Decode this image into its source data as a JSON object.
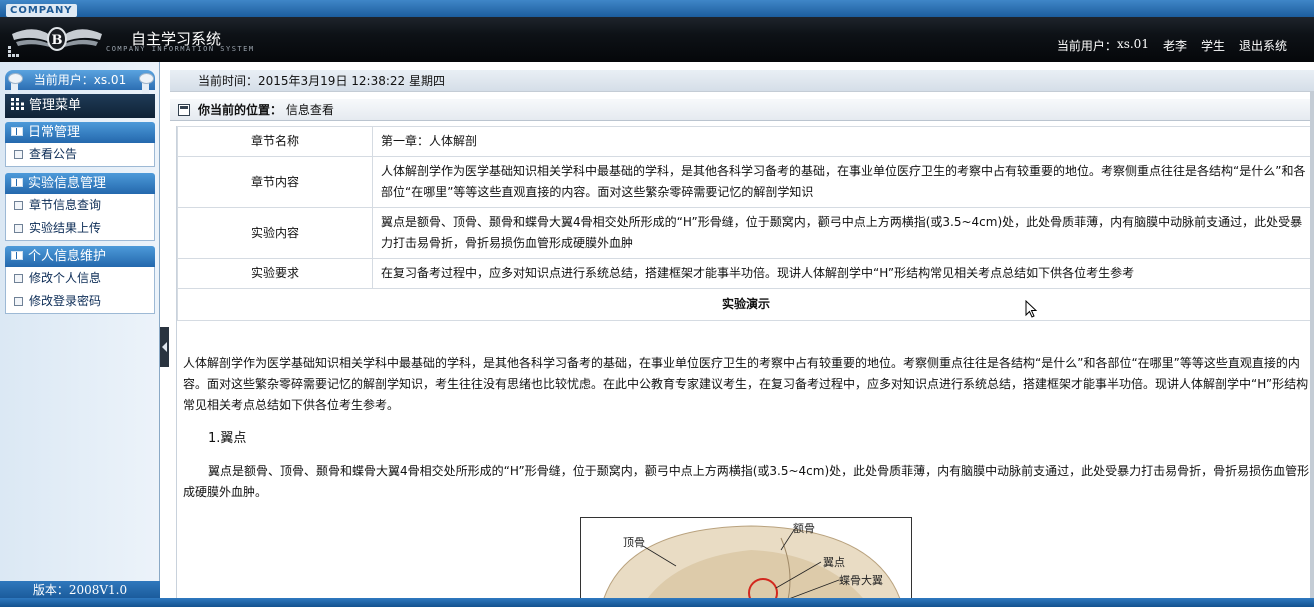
{
  "header": {
    "company_tag": "COMPANY",
    "system_title": "自主学习系统",
    "company_subtitle": "COMPANY INFORMATION SYSTEM",
    "current_user_label": "当前用户：",
    "user_id": "xs.01",
    "user_name": "老李",
    "user_role": "学生",
    "logout": "退出系统"
  },
  "sidebar": {
    "current_user": "当前用户：xs.01",
    "menu_title": "管理菜单",
    "sections": [
      {
        "title": "日常管理",
        "items": [
          "查看公告"
        ]
      },
      {
        "title": "实验信息管理",
        "items": [
          "章节信息查询",
          "实验结果上传"
        ]
      },
      {
        "title": "个人信息维护",
        "items": [
          "修改个人信息",
          "修改登录密码"
        ]
      }
    ],
    "version": "版本：2008V1.0"
  },
  "time_bar": "当前时间：2015年3月19日 12:38:22 星期四",
  "location": {
    "label": "你当前的位置：",
    "value": "信息查看"
  },
  "info_table": [
    {
      "label": "章节名称",
      "value": "第一章：人体解剖"
    },
    {
      "label": "章节内容",
      "value": "人体解剖学作为医学基础知识相关学科中最基础的学科，是其他各科学习备考的基础，在事业单位医疗卫生的考察中占有较重要的地位。考察侧重点往往是各结构“是什么”和各部位“在哪里”等等这些直观直接的内容。面对这些繁杂零碎需要记忆的解剖学知识"
    },
    {
      "label": "实验内容",
      "value": "翼点是额骨、顶骨、颞骨和蝶骨大翼4骨相交处所形成的“H”形骨缝，位于颞窝内，颧弓中点上方两横指(或3.5~4cm)处，此处骨质菲薄，内有脑膜中动脉前支通过，此处受暴力打击易骨折，骨折易损伤血管形成硬膜外血肿"
    },
    {
      "label": "实验要求",
      "value": "在复习备考过程中，应多对知识点进行系统总结，搭建框架才能事半功倍。现讲人体解剖学中“H”形结构常见相关考点总结如下供各位考生参考"
    }
  ],
  "demo_title": "实验演示",
  "article": {
    "intro": "人体解剖学作为医学基础知识相关学科中最基础的学科，是其他各科学习备考的基础，在事业单位医疗卫生的考察中占有较重要的地位。考察侧重点往往是各结构“是什么”和各部位“在哪里”等等这些直观直接的内容。面对这些繁杂零碎需要记忆的解剖学知识，考生往往没有思绪也比较忧虑。在此中公教育专家建议考生，在复习备考过程中，应多对知识点进行系统总结，搭建框架才能事半功倍。现讲人体解剖学中“H”形结构常见相关考点总结如下供各位考生参考。",
    "heading": "1.翼点",
    "body": "翼点是额骨、顶骨、颞骨和蝶骨大翼4骨相交处所形成的“H”形骨缝，位于颞窝内，颧弓中点上方两横指(或3.5~4cm)处，此处骨质菲薄，内有脑膜中动脉前支通过，此处受暴力打击易骨折，骨折易损伤血管形成硬膜外血肿。"
  },
  "diagram_labels": {
    "parietal": "顶骨",
    "frontal": "额骨",
    "pterion": "翼点",
    "sphenoid": "蝶骨大翼"
  }
}
